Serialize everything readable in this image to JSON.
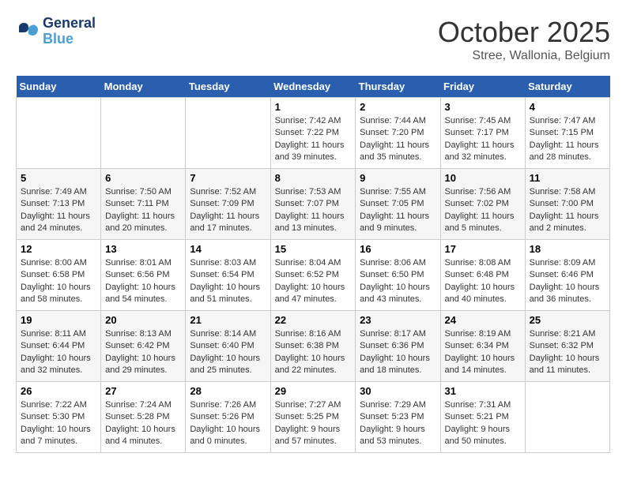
{
  "header": {
    "logo_line1": "General",
    "logo_line2": "Blue",
    "month": "October 2025",
    "location": "Stree, Wallonia, Belgium"
  },
  "days_of_week": [
    "Sunday",
    "Monday",
    "Tuesday",
    "Wednesday",
    "Thursday",
    "Friday",
    "Saturday"
  ],
  "weeks": [
    [
      {
        "day": "",
        "info": ""
      },
      {
        "day": "",
        "info": ""
      },
      {
        "day": "",
        "info": ""
      },
      {
        "day": "1",
        "info": "Sunrise: 7:42 AM\nSunset: 7:22 PM\nDaylight: 11 hours and 39 minutes."
      },
      {
        "day": "2",
        "info": "Sunrise: 7:44 AM\nSunset: 7:20 PM\nDaylight: 11 hours and 35 minutes."
      },
      {
        "day": "3",
        "info": "Sunrise: 7:45 AM\nSunset: 7:17 PM\nDaylight: 11 hours and 32 minutes."
      },
      {
        "day": "4",
        "info": "Sunrise: 7:47 AM\nSunset: 7:15 PM\nDaylight: 11 hours and 28 minutes."
      }
    ],
    [
      {
        "day": "5",
        "info": "Sunrise: 7:49 AM\nSunset: 7:13 PM\nDaylight: 11 hours and 24 minutes."
      },
      {
        "day": "6",
        "info": "Sunrise: 7:50 AM\nSunset: 7:11 PM\nDaylight: 11 hours and 20 minutes."
      },
      {
        "day": "7",
        "info": "Sunrise: 7:52 AM\nSunset: 7:09 PM\nDaylight: 11 hours and 17 minutes."
      },
      {
        "day": "8",
        "info": "Sunrise: 7:53 AM\nSunset: 7:07 PM\nDaylight: 11 hours and 13 minutes."
      },
      {
        "day": "9",
        "info": "Sunrise: 7:55 AM\nSunset: 7:05 PM\nDaylight: 11 hours and 9 minutes."
      },
      {
        "day": "10",
        "info": "Sunrise: 7:56 AM\nSunset: 7:02 PM\nDaylight: 11 hours and 5 minutes."
      },
      {
        "day": "11",
        "info": "Sunrise: 7:58 AM\nSunset: 7:00 PM\nDaylight: 11 hours and 2 minutes."
      }
    ],
    [
      {
        "day": "12",
        "info": "Sunrise: 8:00 AM\nSunset: 6:58 PM\nDaylight: 10 hours and 58 minutes."
      },
      {
        "day": "13",
        "info": "Sunrise: 8:01 AM\nSunset: 6:56 PM\nDaylight: 10 hours and 54 minutes."
      },
      {
        "day": "14",
        "info": "Sunrise: 8:03 AM\nSunset: 6:54 PM\nDaylight: 10 hours and 51 minutes."
      },
      {
        "day": "15",
        "info": "Sunrise: 8:04 AM\nSunset: 6:52 PM\nDaylight: 10 hours and 47 minutes."
      },
      {
        "day": "16",
        "info": "Sunrise: 8:06 AM\nSunset: 6:50 PM\nDaylight: 10 hours and 43 minutes."
      },
      {
        "day": "17",
        "info": "Sunrise: 8:08 AM\nSunset: 6:48 PM\nDaylight: 10 hours and 40 minutes."
      },
      {
        "day": "18",
        "info": "Sunrise: 8:09 AM\nSunset: 6:46 PM\nDaylight: 10 hours and 36 minutes."
      }
    ],
    [
      {
        "day": "19",
        "info": "Sunrise: 8:11 AM\nSunset: 6:44 PM\nDaylight: 10 hours and 32 minutes."
      },
      {
        "day": "20",
        "info": "Sunrise: 8:13 AM\nSunset: 6:42 PM\nDaylight: 10 hours and 29 minutes."
      },
      {
        "day": "21",
        "info": "Sunrise: 8:14 AM\nSunset: 6:40 PM\nDaylight: 10 hours and 25 minutes."
      },
      {
        "day": "22",
        "info": "Sunrise: 8:16 AM\nSunset: 6:38 PM\nDaylight: 10 hours and 22 minutes."
      },
      {
        "day": "23",
        "info": "Sunrise: 8:17 AM\nSunset: 6:36 PM\nDaylight: 10 hours and 18 minutes."
      },
      {
        "day": "24",
        "info": "Sunrise: 8:19 AM\nSunset: 6:34 PM\nDaylight: 10 hours and 14 minutes."
      },
      {
        "day": "25",
        "info": "Sunrise: 8:21 AM\nSunset: 6:32 PM\nDaylight: 10 hours and 11 minutes."
      }
    ],
    [
      {
        "day": "26",
        "info": "Sunrise: 7:22 AM\nSunset: 5:30 PM\nDaylight: 10 hours and 7 minutes."
      },
      {
        "day": "27",
        "info": "Sunrise: 7:24 AM\nSunset: 5:28 PM\nDaylight: 10 hours and 4 minutes."
      },
      {
        "day": "28",
        "info": "Sunrise: 7:26 AM\nSunset: 5:26 PM\nDaylight: 10 hours and 0 minutes."
      },
      {
        "day": "29",
        "info": "Sunrise: 7:27 AM\nSunset: 5:25 PM\nDaylight: 9 hours and 57 minutes."
      },
      {
        "day": "30",
        "info": "Sunrise: 7:29 AM\nSunset: 5:23 PM\nDaylight: 9 hours and 53 minutes."
      },
      {
        "day": "31",
        "info": "Sunrise: 7:31 AM\nSunset: 5:21 PM\nDaylight: 9 hours and 50 minutes."
      },
      {
        "day": "",
        "info": ""
      }
    ]
  ]
}
